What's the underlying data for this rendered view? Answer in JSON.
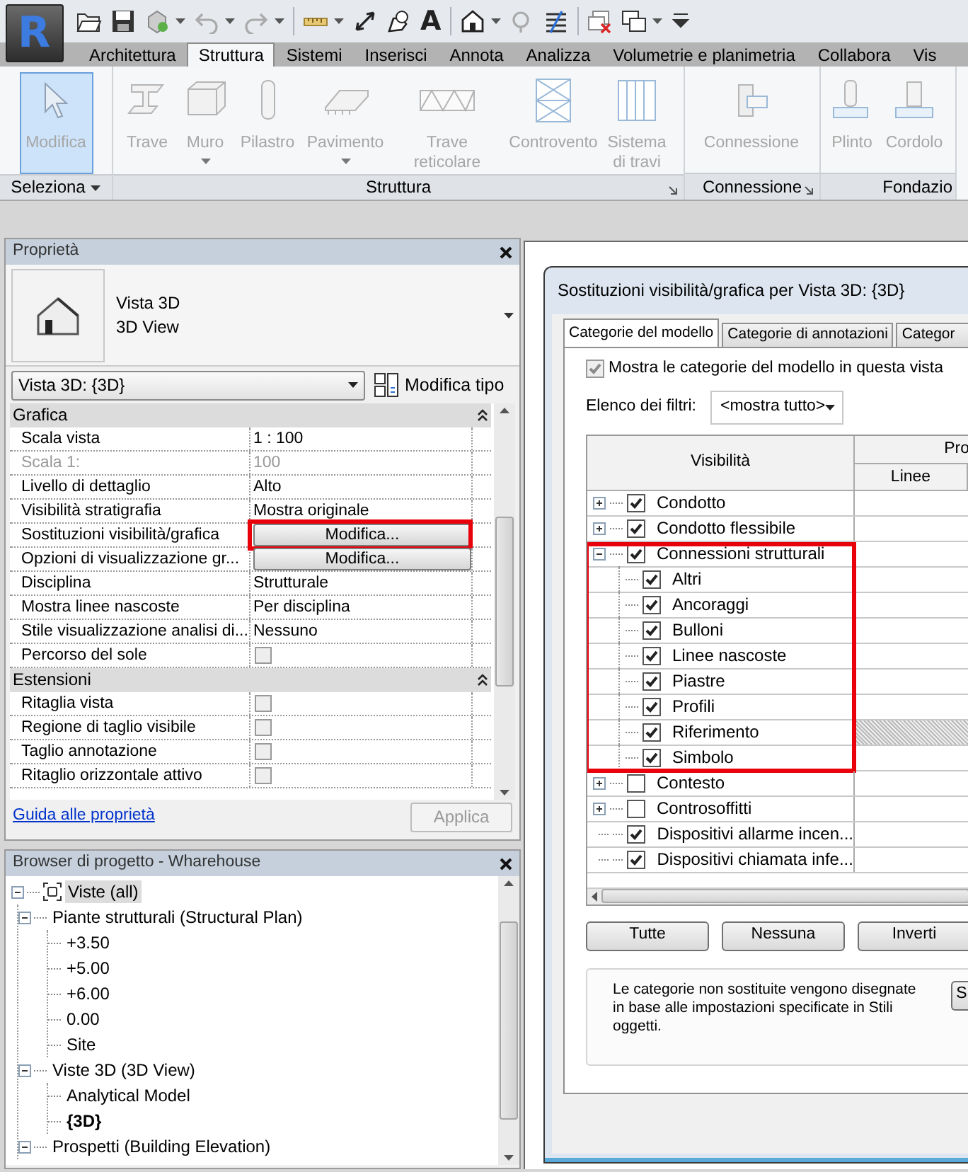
{
  "app_button": {
    "logo": "R"
  },
  "quick_access": {
    "text_tool": "A"
  },
  "ribbon_tabs": [
    {
      "label": "Architettura",
      "selected": false
    },
    {
      "label": "Struttura",
      "selected": true
    },
    {
      "label": "Sistemi",
      "selected": false
    },
    {
      "label": "Inserisci",
      "selected": false
    },
    {
      "label": "Annota",
      "selected": false
    },
    {
      "label": "Analizza",
      "selected": false
    },
    {
      "label": "Volumetrie e planimetria",
      "selected": false
    },
    {
      "label": "Collabora",
      "selected": false
    },
    {
      "label": "Vis",
      "selected": false
    }
  ],
  "ribbon_panels": [
    {
      "title": "Seleziona",
      "menu": true,
      "launcher": false,
      "buttons": [
        {
          "label": "Modifica",
          "selected": true,
          "disabled": true,
          "menu": false
        }
      ]
    },
    {
      "title": "Struttura",
      "menu": false,
      "launcher": true,
      "buttons": [
        {
          "label": "Trave",
          "selected": false,
          "disabled": true,
          "menu": false
        },
        {
          "label": "Muro",
          "selected": false,
          "disabled": true,
          "menu": true
        },
        {
          "label": "Pilastro",
          "selected": false,
          "disabled": true,
          "menu": false
        },
        {
          "label": "Pavimento",
          "selected": false,
          "disabled": true,
          "menu": true
        },
        {
          "label": "Trave reticolare",
          "selected": false,
          "disabled": true,
          "menu": false
        },
        {
          "label": "Controvento",
          "selected": false,
          "disabled": true,
          "menu": false
        },
        {
          "label": "Sistema di travi",
          "selected": false,
          "disabled": true,
          "menu": false
        }
      ]
    },
    {
      "title": "Connessione",
      "menu": false,
      "launcher": true,
      "buttons": [
        {
          "label": "Connessione",
          "selected": false,
          "disabled": true,
          "menu": false
        }
      ]
    },
    {
      "title": "Fondazio",
      "menu": false,
      "launcher": false,
      "buttons": [
        {
          "label": "Plinto",
          "selected": false,
          "disabled": true,
          "menu": false
        },
        {
          "label": "Cordolo",
          "selected": false,
          "disabled": true,
          "menu": false
        }
      ]
    }
  ],
  "properties": {
    "title": "Proprietà",
    "type_name": "Vista 3D",
    "type_subname": "3D View",
    "instance": "Vista 3D: {3D}",
    "edit_type": "Modifica tipo",
    "groups": [
      {
        "title": "Grafica",
        "rows": [
          {
            "kind": "text",
            "name": "Scala vista",
            "value": "1 : 100",
            "disabled": false
          },
          {
            "kind": "text",
            "name": "Scala 1:",
            "value": "100",
            "disabled": true
          },
          {
            "kind": "text",
            "name": "Livello di dettaglio",
            "value": "Alto",
            "disabled": false
          },
          {
            "kind": "text",
            "name": "Visibilità stratigrafia",
            "value": "Mostra originale",
            "disabled": false
          },
          {
            "kind": "button",
            "name": "Sostituzioni visibilità/grafica",
            "value": "Modifica...",
            "disabled": false,
            "highlighted": true
          },
          {
            "kind": "button",
            "name": "Opzioni di visualizzazione gr...",
            "value": "Modifica...",
            "disabled": false,
            "highlighted": false
          },
          {
            "kind": "text",
            "name": "Disciplina",
            "value": "Strutturale",
            "disabled": false
          },
          {
            "kind": "text",
            "name": "Mostra linee nascoste",
            "value": "Per disciplina",
            "disabled": false
          },
          {
            "kind": "text",
            "name": "Stile visualizzazione analisi di...",
            "value": "Nessuno",
            "disabled": false
          },
          {
            "kind": "checkbox",
            "name": "Percorso del sole",
            "checked": false,
            "disabled": false
          }
        ]
      },
      {
        "title": "Estensioni",
        "rows": [
          {
            "kind": "checkbox",
            "name": "Ritaglia vista",
            "checked": false,
            "disabled": false
          },
          {
            "kind": "checkbox",
            "name": "Regione di taglio visibile",
            "checked": false,
            "disabled": false
          },
          {
            "kind": "checkbox",
            "name": "Taglio annotazione",
            "checked": false,
            "disabled": false
          },
          {
            "kind": "checkbox",
            "name": "Ritaglio orizzontale attivo",
            "checked": false,
            "disabled": false
          }
        ]
      }
    ],
    "help_link": "Guida alle proprietà",
    "apply": "Applica"
  },
  "browser": {
    "title": "Browser di progetto - Wharehouse",
    "tree": [
      {
        "label": "Viste (all)",
        "selected": true,
        "active_view": false,
        "expanded": true,
        "children": [
          {
            "label": "Piante strutturali (Structural Plan)",
            "selected": false,
            "active_view": false,
            "expanded": true,
            "children": [
              {
                "label": "+3.50",
                "selected": false,
                "active_view": false
              },
              {
                "label": "+5.00",
                "selected": false,
                "active_view": false
              },
              {
                "label": "+6.00",
                "selected": false,
                "active_view": false
              },
              {
                "label": "0.00",
                "selected": false,
                "active_view": false
              },
              {
                "label": "Site",
                "selected": false,
                "active_view": false
              }
            ]
          },
          {
            "label": "Viste 3D (3D View)",
            "selected": false,
            "active_view": false,
            "expanded": true,
            "children": [
              {
                "label": "Analytical Model",
                "selected": false,
                "active_view": false
              },
              {
                "label": "{3D}",
                "selected": false,
                "active_view": true
              }
            ]
          },
          {
            "label": "Prospetti (Building Elevation)",
            "selected": false,
            "active_view": false,
            "expanded": true
          }
        ]
      }
    ]
  },
  "dialog": {
    "title": "Sostituzioni visibilità/grafica per Vista 3D: {3D}",
    "tabs": [
      {
        "label": "Categorie del modello",
        "selected": true
      },
      {
        "label": "Categorie di annotazioni",
        "selected": false
      },
      {
        "label": "Categor",
        "selected": false
      }
    ],
    "show_categories": {
      "label": "Mostra le categorie del modello in questa vista",
      "checked": true,
      "disabled": true
    },
    "filter": {
      "label": "Elenco dei filtri:",
      "value": "<mostra tutto>"
    },
    "columns": {
      "visibility": "Visibilità",
      "projection": "Pro",
      "lines": "Linee"
    },
    "categories": [
      {
        "label": "Condotto",
        "checked": true,
        "expanded": false,
        "highlighted": false,
        "hatched": false
      },
      {
        "label": "Condotto flessibile",
        "checked": true,
        "expanded": false,
        "highlighted": false,
        "hatched": false
      },
      {
        "label": "Connessioni strutturali",
        "checked": true,
        "expanded": true,
        "highlighted": true,
        "hatched": false,
        "children": [
          {
            "label": "Altri",
            "checked": true,
            "hatched": false
          },
          {
            "label": "Ancoraggi",
            "checked": true,
            "hatched": false
          },
          {
            "label": "Bulloni",
            "checked": true,
            "hatched": false
          },
          {
            "label": "Linee nascoste",
            "checked": true,
            "hatched": false
          },
          {
            "label": "Piastre",
            "checked": true,
            "hatched": false
          },
          {
            "label": "Profili",
            "checked": true,
            "hatched": false
          },
          {
            "label": "Riferimento",
            "checked": true,
            "hatched": true
          },
          {
            "label": "Simbolo",
            "checked": true,
            "hatched": false
          }
        ]
      },
      {
        "label": "Contesto",
        "checked": false,
        "expanded": false,
        "highlighted": false,
        "hatched": false
      },
      {
        "label": "Controsoffitti",
        "checked": false,
        "expanded": false,
        "highlighted": false,
        "hatched": false
      },
      {
        "label": "Dispositivi allarme incen...",
        "checked": true,
        "highlighted": false,
        "hatched": false
      },
      {
        "label": "Dispositivi chiamata infe...",
        "checked": true,
        "highlighted": false,
        "hatched": false
      }
    ],
    "buttons": [
      "Tutte",
      "Nessuna",
      "Inverti"
    ],
    "note": "Le categorie non sostituite vengono disegnate in base alle impostazioni specificate in Stili oggetti.",
    "note_button": "S"
  }
}
